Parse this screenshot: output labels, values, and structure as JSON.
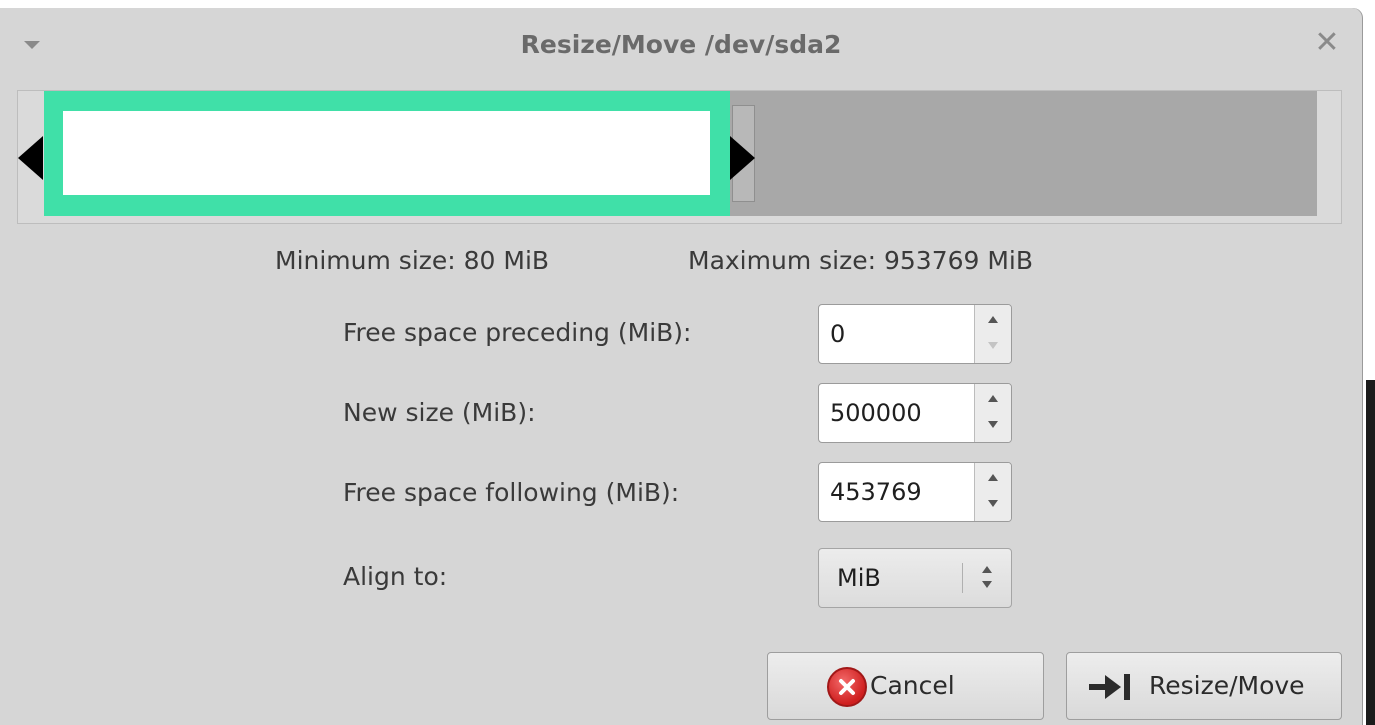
{
  "window": {
    "title": "Resize/Move /dev/sda2",
    "menu_icon": "chevron-down-icon",
    "close_icon": "close-icon",
    "close_glyph": "✕"
  },
  "partition_graphic": {
    "partition_color": "#40e0a8",
    "unallocated_color": "#a8a8a8",
    "used_fraction_of_disk": 0.524
  },
  "limits": {
    "minimum": "Minimum size: 80 MiB",
    "maximum": "Maximum size: 953769 MiB"
  },
  "form": {
    "free_preceding": {
      "label": "Free space preceding (MiB):",
      "value": "0"
    },
    "new_size": {
      "label": "New size (MiB):",
      "value": "500000"
    },
    "free_following": {
      "label": "Free space following (MiB):",
      "value": "453769"
    },
    "align": {
      "label": "Align to:",
      "value": "MiB"
    }
  },
  "buttons": {
    "cancel": {
      "label": "Cancel",
      "icon": "cancel-icon"
    },
    "apply": {
      "label": "Resize/Move",
      "icon": "arrow-to-bar-icon"
    }
  }
}
